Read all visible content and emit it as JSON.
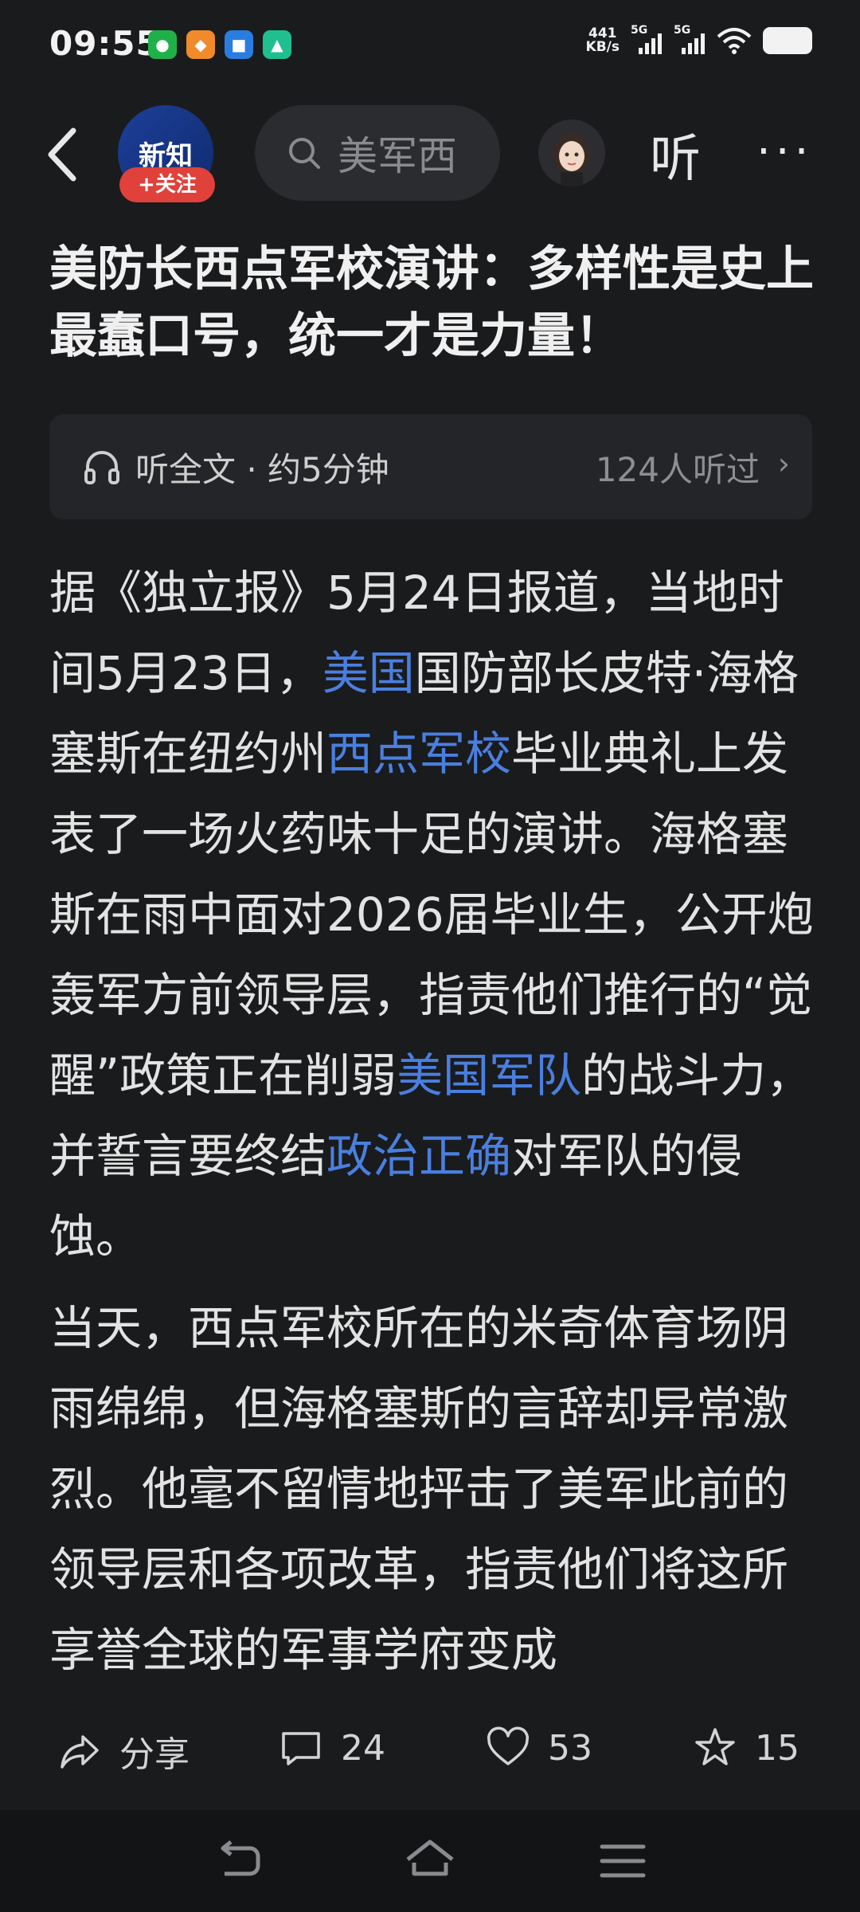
{
  "status_bar": {
    "time": "09:55",
    "net_speed_value": "441",
    "net_speed_unit": "KB/s",
    "signal_1": "5G",
    "signal_2": "5G",
    "app_icons": [
      "wechat-icon",
      "app-icon-orange",
      "app-icon-blue",
      "app-icon-green"
    ]
  },
  "nav": {
    "channel_logo_text": "新知",
    "follow_label": "+关注",
    "search_placeholder": "美军西",
    "listen_label": "听",
    "more_label": "···"
  },
  "article": {
    "title": "美防长西点军校演讲：多样性是史上最蠢口号，统一才是力量！",
    "listen_bar": {
      "label": "听全文 · 约5分钟",
      "count": "124人听过"
    },
    "paragraphs": [
      {
        "segments": [
          {
            "text": "据《独立报》5月24日报道，当地时间5月23日，",
            "link": false
          },
          {
            "text": "美国",
            "link": true
          },
          {
            "text": "国防部长皮特·海格塞斯在纽约州",
            "link": false
          },
          {
            "text": "西点军校",
            "link": true
          },
          {
            "text": "毕业典礼上发表了一场火药味十足的演讲。海格塞斯在雨中面对2026届毕业生，公开炮轰军方前领导层，指责他们推行的“觉醒”政策正在削弱",
            "link": false
          },
          {
            "text": "美国军队",
            "link": true
          },
          {
            "text": "的战斗力，并誓言要终结",
            "link": false
          },
          {
            "text": "政治正确",
            "link": true
          },
          {
            "text": "对军队的侵蚀。",
            "link": false
          }
        ]
      },
      {
        "segments": [
          {
            "text": "当天，西点军校所在的米奇体育场阴雨绵绵，但海格塞斯的言辞却异常激烈。他毫不留情地抨击了美军此前的领导层和各项改革，指责他们将这所享誉全球的军事学府变成",
            "link": false
          }
        ]
      }
    ]
  },
  "actions": {
    "share_label": "分享",
    "comment_count": "24",
    "like_count": "53",
    "favorite_count": "15"
  },
  "colors": {
    "background": "#1a1b1d",
    "link": "#4a7fe0",
    "follow_badge": "#e0413b"
  }
}
